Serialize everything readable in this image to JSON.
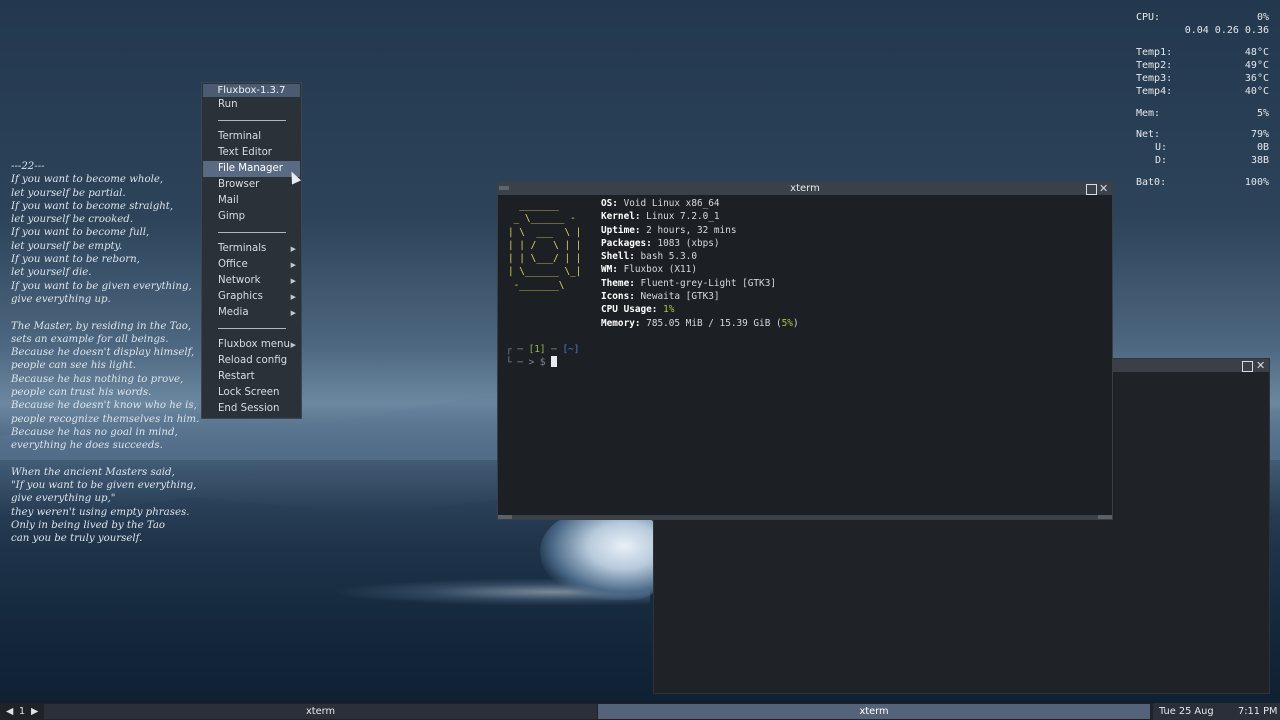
{
  "poem": {
    "lines": [
      "---22---",
      "If you want to become whole,",
      "let yourself be partial.",
      "If you want to become straight,",
      "let yourself be crooked.",
      "If you want to become full,",
      "let yourself be empty.",
      "If you want to be reborn,",
      "let yourself die.",
      "If you want to be given everything,",
      "give everything up.",
      "",
      "The Master, by residing in the Tao,",
      "sets an example for all beings.",
      "Because he doesn't display himself,",
      "people can see his light.",
      "Because he has nothing to prove,",
      "people can trust his words.",
      "Because he doesn't know who he is,",
      "people recognize themselves in him.",
      "Because he has no goal in mind,",
      "everything he does succeeds.",
      "",
      "When the ancient Masters said,",
      "\"If you want to be given everything,",
      "give everything up,\"",
      "they weren't using empty phrases.",
      "Only in being lived by the Tao",
      "can you be truly yourself."
    ]
  },
  "conky": {
    "cpu_label": "CPU:",
    "cpu_value": "0%",
    "loadavg": "0.04 0.26 0.36",
    "temp1_label": "Temp1:",
    "temp1": "48°C",
    "temp2_label": "Temp2:",
    "temp2": "49°C",
    "temp3_label": "Temp3:",
    "temp3": "36°C",
    "temp4_label": "Temp4:",
    "temp4": "40°C",
    "mem_label": "Mem:",
    "mem": "5%",
    "net_label": "Net:",
    "net": "79%",
    "up_label": "U:",
    "up": "0B",
    "down_label": "D:",
    "down": "38B",
    "bat_label": "Bat0:",
    "bat": "100%"
  },
  "menu": {
    "title": "Fluxbox-1.3.7",
    "run": "Run",
    "terminal": "Terminal",
    "text_editor": "Text Editor",
    "file_manager": "File Manager",
    "browser": "Browser",
    "mail": "Mail",
    "gimp": "Gimp",
    "terminals": "Terminals",
    "office": "Office",
    "network": "Network",
    "graphics": "Graphics",
    "media": "Media",
    "fluxbox_menu": "Fluxbox menu",
    "reload_config": "Reload config",
    "restart": "Restart",
    "lock_screen": "Lock Screen",
    "end_session": "End Session",
    "submenu_arrow": "▶"
  },
  "xterm": {
    "title": "xterm",
    "ascii_art": "  _______\n _ \\______ -\n| \\  ___  \\ |\n| | /   \\ | |\n| | \\___/ | |\n| \\______ \\_|\n -_______\\",
    "os_label": "OS:",
    "os": "Void Linux x86_64",
    "kernel_label": "Kernel:",
    "kernel": "Linux 7.2.0_1",
    "uptime_label": "Uptime:",
    "uptime": "2 hours, 32 mins",
    "packages_label": "Packages:",
    "packages": "1083 (xbps)",
    "shell_label": "Shell:",
    "shell": "bash 5.3.0",
    "wm_label": "WM:",
    "wm": "Fluxbox (X11)",
    "theme_label": "Theme:",
    "theme": "Fluent-grey-Light [GTK3]",
    "icons_label": "Icons:",
    "icons": "Newaita [GTK3]",
    "cpu_usage_label": "CPU Usage:",
    "cpu_usage": "1%",
    "memory_label": "Memory:",
    "memory": "785.05 MiB / 15.39 GiB (",
    "memory_pct": "5%",
    "memory_close": ")",
    "prompt_line1_a": "┌ ─ ",
    "prompt_line1_b": "[1]",
    "prompt_line1_c": " ─ ",
    "prompt_line1_d": "[~]",
    "prompt_line2": "└ ─ > $ "
  },
  "taskbar": {
    "prev_ws": "◀",
    "ws_number": "1",
    "next_ws": "▶",
    "task1": "xterm",
    "task2": "xterm",
    "date": "Tue 25 Aug",
    "time": "7:11 PM"
  },
  "colors": {
    "menu_highlight": "#5a6a82",
    "ascii_art": "#e2d75b",
    "prompt_blue": "#4c7cd6",
    "prompt_green": "#9dbb4a"
  },
  "icons": [
    "maximize-icon",
    "close-icon",
    "submenu-arrow-icon",
    "mouse-cursor-icon"
  ]
}
